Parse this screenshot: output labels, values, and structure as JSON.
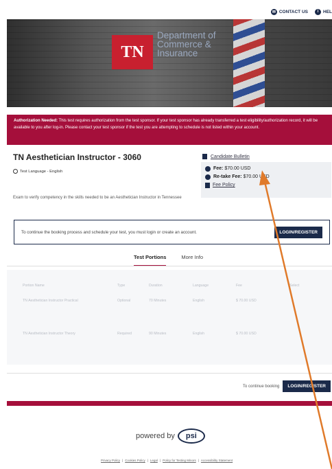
{
  "header": {
    "contact_label": "CONTACT US",
    "help_label": "HEL"
  },
  "banner": {
    "logo_text": "TN",
    "dept_line1": "Department of",
    "dept_line2": "Commerce &",
    "dept_line3": "Insurance"
  },
  "auth": {
    "strong": "Authorization Needed:",
    "text": " This test requires authorization from the test sponsor. If your test sponsor has already transferred a test eligibility/authorization record, it will be available to you after log-in. Please contact your test sponsor if the test you are attempting to schedule is not listed within your account."
  },
  "exam": {
    "title": "TN Aesthetician Instructor - 3060",
    "language": "Test Language - English",
    "description": "Exam to verify competency in the skills needed to be an Aesthetician Instructor in Tennessee"
  },
  "sidebar": {
    "bulletin": "Candidate Bulletin",
    "fee_label": "Fee:",
    "fee_value": " $70.00 USD",
    "retake_label": "Re-take Fee:",
    "retake_value": " $70.00 USD",
    "fee_policy": "Fee Policy"
  },
  "login_box": {
    "text": "To continue the booking process and schedule your test, you must login or create an account.",
    "button": "LOGIN/REGISTER"
  },
  "tabs": [
    {
      "label": "Test Portions"
    },
    {
      "label": "More Info"
    }
  ],
  "table": {
    "headers": [
      "Portion Name",
      "Type",
      "Duration",
      "Language",
      "Fee",
      "Select"
    ],
    "rows": [
      [
        "TN Aesthetician Instructor Practical",
        "Optional",
        "70 Minutes",
        "English",
        "$ 70.00 USD",
        ""
      ],
      [
        "TN Aesthetician Instructor Theory",
        "Required",
        "90 Minutes",
        "English",
        "$ 70.00 USD",
        ""
      ]
    ]
  },
  "footer_bar": {
    "text": "To continue booking",
    "button": "LOGIN/REGISTER"
  },
  "powered": {
    "text": "powered by",
    "brand": "psi"
  },
  "links": [
    "Privacy Policy",
    "Cookies Policy",
    "Legal",
    "Policy for Testing Minors",
    "Accessibility Statement"
  ],
  "colors": {
    "accent": "#a50f3b",
    "navy": "#1b2a4a",
    "arrow": "#e07a2a"
  }
}
